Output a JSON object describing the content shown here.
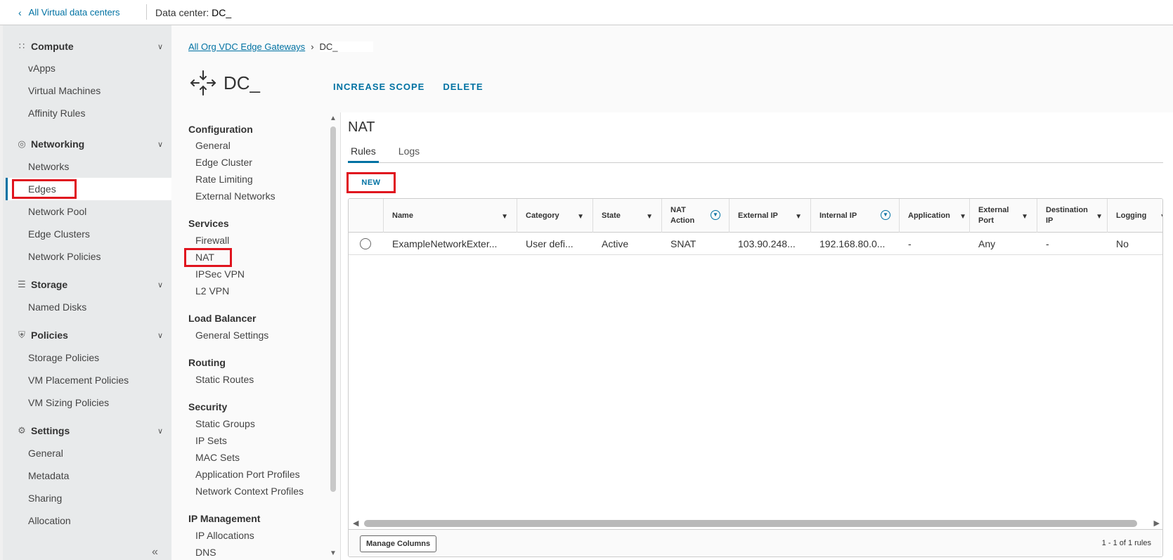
{
  "topbar": {
    "back_label": "All Virtual data centers",
    "dc_prefix": "Data center:",
    "dc_name": "DC_"
  },
  "sidebar": {
    "groups": [
      {
        "label": "Compute",
        "icon": "grid-icon",
        "items": [
          "vApps",
          "Virtual Machines",
          "Affinity Rules"
        ]
      },
      {
        "label": "Networking",
        "icon": "network-globe-icon",
        "items": [
          "Networks",
          "Edges",
          "Network Pool",
          "Edge Clusters",
          "Network Policies"
        ]
      },
      {
        "label": "Storage",
        "icon": "storage-icon",
        "items": [
          "Named Disks"
        ]
      },
      {
        "label": "Policies",
        "icon": "shield-icon",
        "items": [
          "Storage Policies",
          "VM Placement Policies",
          "VM Sizing Policies"
        ]
      },
      {
        "label": "Settings",
        "icon": "gear-icon",
        "items": [
          "General",
          "Metadata",
          "Sharing",
          "Allocation"
        ]
      }
    ],
    "active_item": "Edges",
    "collapse_icon": "double-chevron-left-icon"
  },
  "breadcrumb": {
    "link": "All Org VDC Edge Gateways",
    "current": "DC_"
  },
  "edge": {
    "name": "DC_",
    "icon": "edge-gateway-icon",
    "actions": [
      "INCREASE SCOPE",
      "DELETE"
    ]
  },
  "subnav": {
    "sections": [
      {
        "header": "Configuration",
        "items": [
          "General",
          "Edge Cluster",
          "Rate Limiting",
          "External Networks"
        ]
      },
      {
        "header": "Services",
        "items": [
          "Firewall",
          "NAT",
          "IPSec VPN",
          "L2 VPN"
        ]
      },
      {
        "header": "Load Balancer",
        "items": [
          "General Settings"
        ]
      },
      {
        "header": "Routing",
        "items": [
          "Static Routes"
        ]
      },
      {
        "header": "Security",
        "items": [
          "Static Groups",
          "IP Sets",
          "MAC Sets",
          "Application Port Profiles",
          "Network Context Profiles"
        ]
      },
      {
        "header": "IP Management",
        "items": [
          "IP Allocations",
          "DNS"
        ]
      }
    ],
    "active_item": "NAT"
  },
  "content": {
    "title": "NAT",
    "tabs": [
      "Rules",
      "Logs"
    ],
    "active_tab": "Rules",
    "new_label": "NEW",
    "columns": [
      "Name",
      "Category",
      "State",
      "NAT Action",
      "External IP",
      "Internal IP",
      "Application",
      "External Port",
      "Destination IP",
      "Logging"
    ],
    "rows": [
      [
        "ExampleNetworkExter...",
        "User defi...",
        "Active",
        "SNAT",
        "103.90.248...",
        "192.168.80.0...",
        "-",
        "Any",
        "-",
        "No"
      ]
    ],
    "manage_columns_label": "Manage Columns",
    "footer_count": "1 - 1 of 1 rules"
  },
  "colors": {
    "accent": "#0072a3",
    "highlight_box": "#e0141e",
    "sidebar_bg": "#e8eaeb"
  }
}
